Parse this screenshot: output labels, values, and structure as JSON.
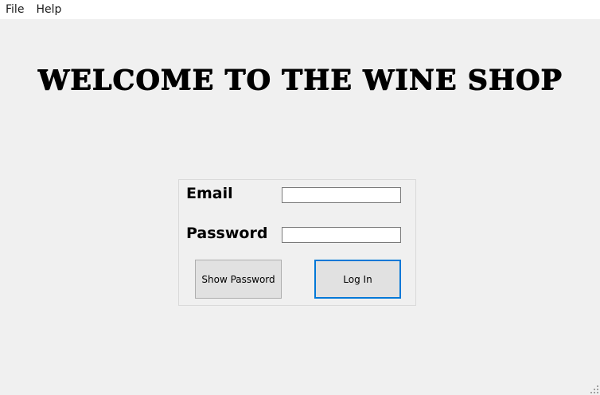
{
  "menubar": {
    "items": [
      {
        "label": "File"
      },
      {
        "label": "Help"
      }
    ]
  },
  "title": "WELCOME TO THE WINE SHOP",
  "form": {
    "email_label": "Email",
    "email_value": "",
    "password_label": "Password",
    "password_value": "",
    "show_password_label": "Show Password",
    "login_label": "Log In"
  }
}
